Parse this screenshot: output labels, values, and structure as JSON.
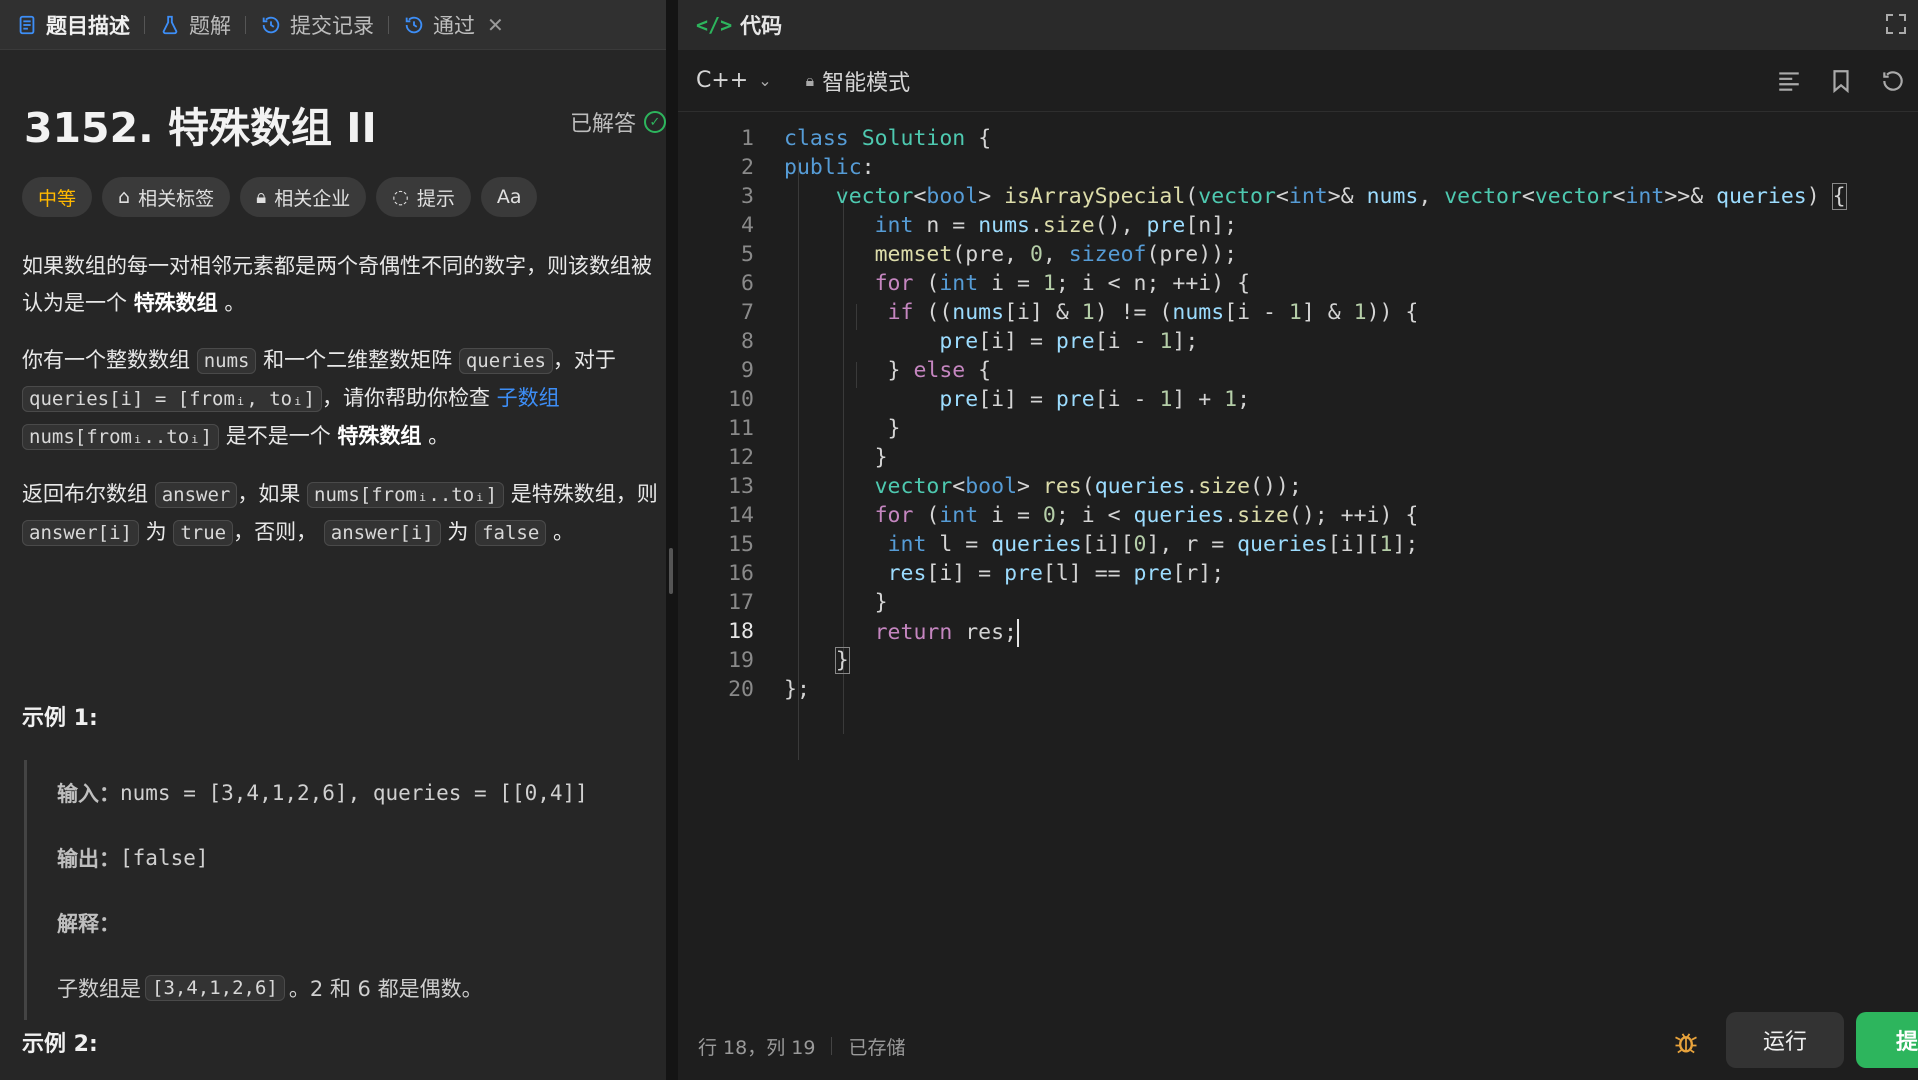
{
  "tabs": [
    {
      "label": "题目描述",
      "icon": "document-icon"
    },
    {
      "label": "题解",
      "icon": "flask-icon"
    },
    {
      "label": "提交记录",
      "icon": "history-icon"
    },
    {
      "label": "通过",
      "icon": "history-icon"
    }
  ],
  "problem": {
    "title": "3152. 特殊数组 II",
    "solved_label": "已解答",
    "difficulty": "中等",
    "chips": [
      "相关标签",
      "相关企业",
      "提示",
      "Aa"
    ]
  },
  "description": {
    "p1a": "如果数组的每一对相邻元素都是两个奇偶性不同的数字，则该数组被认为是一个",
    "p1b": "特殊数组",
    "p1c": "。",
    "p2a": "你有一个整数数组",
    "p2_nums": "nums",
    "p2b": "和一个二维整数矩阵",
    "p2_queries": "queries",
    "p2c": "，对于",
    "p2_qi": "queries[i] = [fromᵢ, toᵢ]",
    "p2d": "，请你帮助你检查",
    "p2_link": "子数组",
    "p2_range": "nums[fromᵢ..toᵢ]",
    "p2e": "是不是一个",
    "p2f": "特殊数组",
    "p2g": "。",
    "p3a": "返回布尔数组",
    "p3_answer": "answer",
    "p3b": "，如果",
    "p3_range": "nums[fromᵢ..toᵢ]",
    "p3c": "是特殊数组，则",
    "p3_ai": "answer[i]",
    "p3d": "为",
    "p3_true": "true",
    "p3e": "，否则，",
    "p3_ai2": "answer[i]",
    "p3f": "为",
    "p3_false": "false",
    "p3g": "。"
  },
  "example1": {
    "title": "示例 1:",
    "input_label": "输入：",
    "input": "nums = [3,4,1,2,6], queries = [[0,4]]",
    "output_label": "输出：",
    "output": "[false]",
    "explain_label": "解释：",
    "explain_a": "子数组是",
    "explain_code": "[3,4,1,2,6]",
    "explain_b": "。2 和 6 都是偶数。"
  },
  "example2": {
    "title": "示例 2:"
  },
  "editor": {
    "header": "代码",
    "language": "C++",
    "mode": "智能模式",
    "current_line": 18,
    "line_numbers": [
      "1",
      "2",
      "3",
      "4",
      "5",
      "6",
      "7",
      "8",
      "9",
      "10",
      "11",
      "12",
      "13",
      "14",
      "15",
      "16",
      "17",
      "18",
      "19",
      "20"
    ]
  },
  "status": {
    "position": "行 18，列 19",
    "saved": "已存储",
    "run_label": "运行",
    "submit_label": "提"
  },
  "colors": {
    "accent_green": "#2db55d",
    "difficulty_medium": "#ffb800",
    "link_blue": "#3d8ef7"
  }
}
